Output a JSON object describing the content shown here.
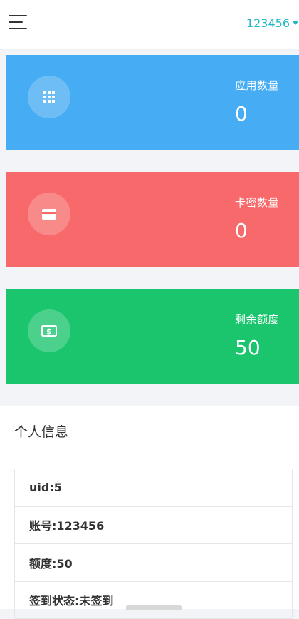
{
  "header": {
    "user_label": "123456"
  },
  "stats": [
    {
      "label": "应用数量",
      "value": "0",
      "icon": "apps-grid-icon",
      "color": "#46acf3"
    },
    {
      "label": "卡密数量",
      "value": "0",
      "icon": "credit-card-icon",
      "color": "#f7696a"
    },
    {
      "label": "剩余额度",
      "value": "50",
      "icon": "dollar-bill-icon",
      "color": "#1ac56d"
    }
  ],
  "profile": {
    "title": "个人信息",
    "rows": [
      "uid:5",
      "账号:123456",
      "额度:50",
      "签到状态:未签到"
    ]
  }
}
